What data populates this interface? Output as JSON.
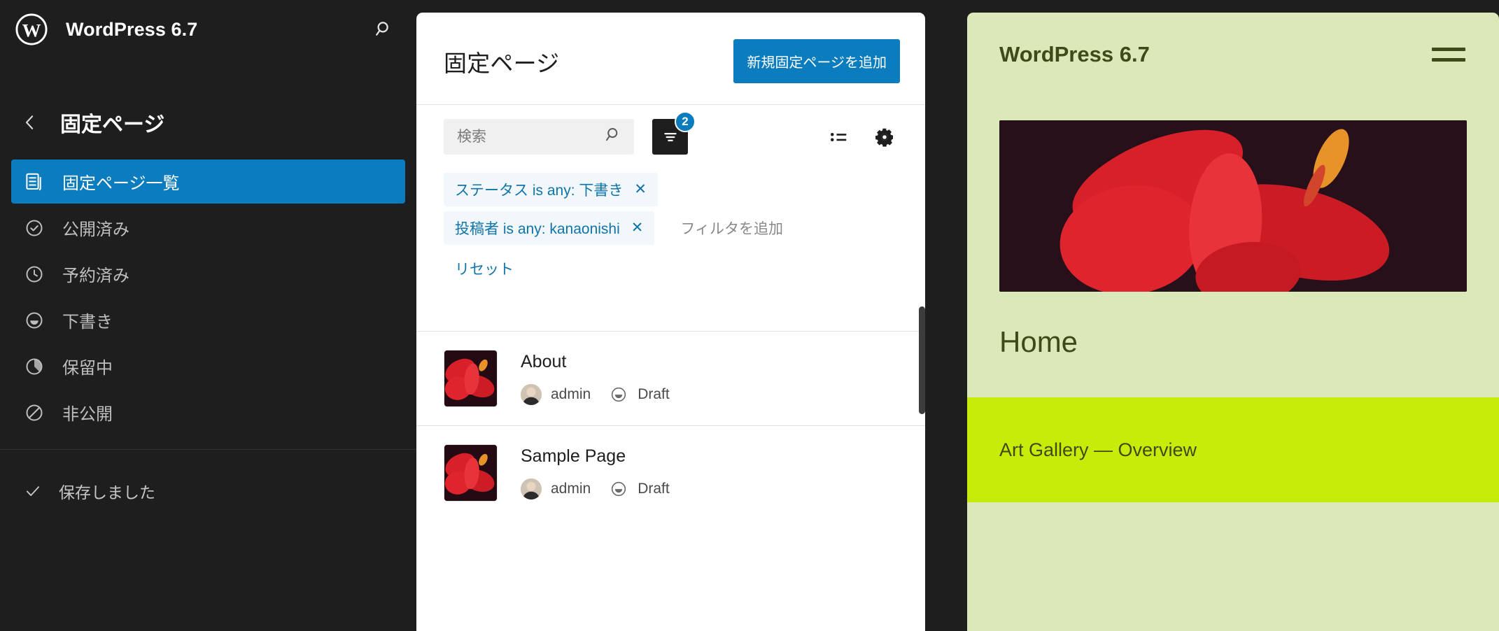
{
  "sidebar": {
    "brand": {
      "title": "WordPress 6.7",
      "logo_icon": "wordpress-logo",
      "search_icon": "search-icon"
    },
    "nav_header": {
      "back_icon": "chevron-left-icon",
      "title": "固定ページ"
    },
    "items": [
      {
        "label": "固定ページ一覧",
        "icon": "pages-icon",
        "active": true
      },
      {
        "label": "公開済み",
        "icon": "published-check-icon",
        "active": false
      },
      {
        "label": "予約済み",
        "icon": "scheduled-clock-icon",
        "active": false
      },
      {
        "label": "下書き",
        "icon": "draft-icon",
        "active": false
      },
      {
        "label": "保留中",
        "icon": "pending-icon",
        "active": false
      },
      {
        "label": "非公開",
        "icon": "private-blocked-icon",
        "active": false
      }
    ],
    "status": {
      "label": "保存しました",
      "icon": "check-icon"
    }
  },
  "main": {
    "title": "固定ページ",
    "add_button": "新規固定ページを追加",
    "search": {
      "placeholder": "検索",
      "value": "",
      "icon": "search-icon"
    },
    "filter_button": {
      "icon": "filter-icon",
      "badge": "2"
    },
    "view_button": {
      "icon": "list-view-icon"
    },
    "settings_button": {
      "icon": "gear-icon"
    },
    "chips": [
      {
        "label": "ステータス is any: 下書き",
        "remove": "✕"
      },
      {
        "label": "投稿者 is any: kanaonishi",
        "remove": "✕"
      }
    ],
    "add_filter_label": "フィルタを追加",
    "reset_label": "リセット",
    "rows": [
      {
        "title": "About",
        "author": "admin",
        "status": "Draft",
        "status_icon": "draft-icon",
        "thumb": "hibiscus-thumbnail",
        "avatar": "user-avatar"
      },
      {
        "title": "Sample Page",
        "author": "admin",
        "status": "Draft",
        "status_icon": "draft-icon",
        "thumb": "hibiscus-thumbnail",
        "avatar": "user-avatar"
      }
    ]
  },
  "preview": {
    "site_title": "WordPress 6.7",
    "menu_icon": "hamburger-menu-icon",
    "hero_image": "hibiscus-flower-image",
    "page_heading": "Home",
    "banner_text": "Art Gallery — Overview"
  },
  "colors": {
    "accent_blue": "#0b7cbd",
    "sidebar_bg": "#1e1e1e",
    "preview_bg": "#dbe8b9",
    "banner_lime": "#c8ec09",
    "preview_text": "#3f4a18"
  }
}
